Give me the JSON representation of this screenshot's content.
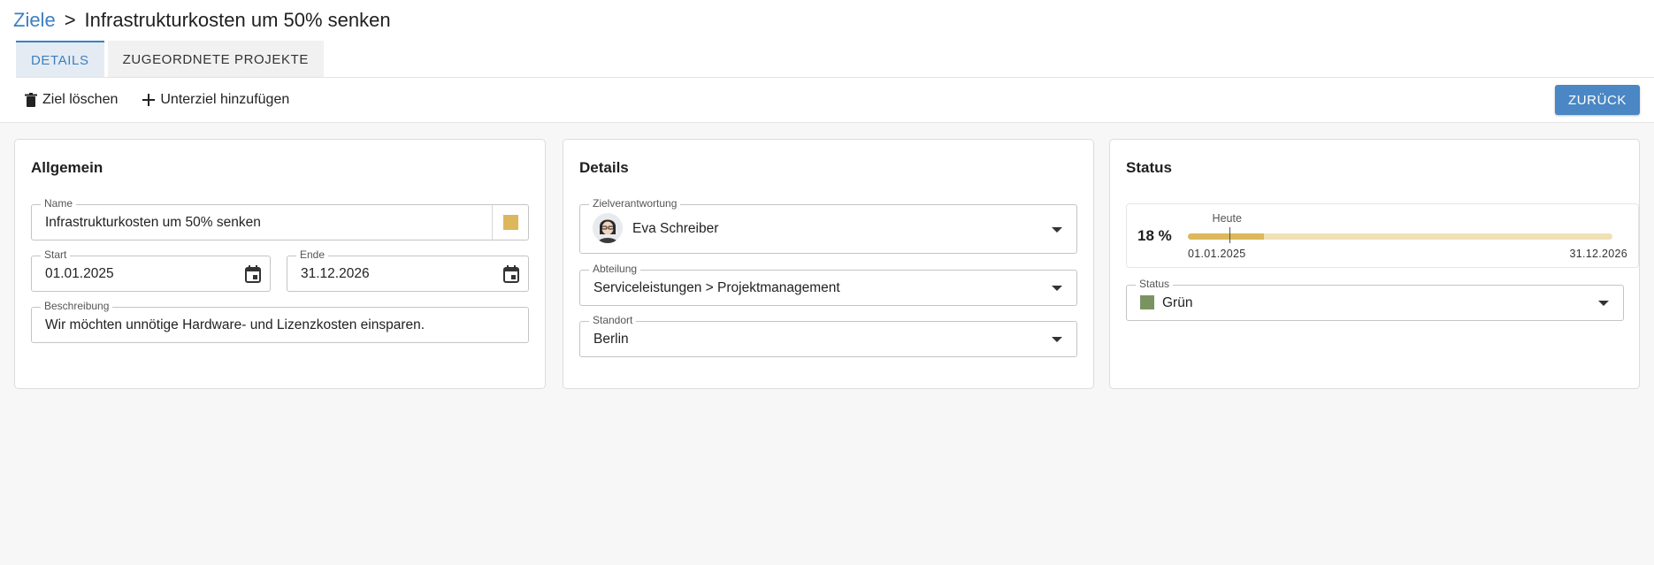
{
  "breadcrumb": {
    "parent": "Ziele",
    "separator": ">",
    "current": "Infrastrukturkosten um 50% senken"
  },
  "tabs": [
    {
      "label": "DETAILS",
      "active": true
    },
    {
      "label": "ZUGEORDNETE PROJEKTE",
      "active": false
    }
  ],
  "toolbar": {
    "delete_label": "Ziel löschen",
    "add_sub_label": "Unterziel hinzufügen",
    "back_label": "ZURÜCK"
  },
  "general": {
    "title": "Allgemein",
    "name_label": "Name",
    "name_value": "Infrastrukturkosten um 50% senken",
    "color": "#dcb75c",
    "start_label": "Start",
    "start_value": "01.01.2025",
    "end_label": "Ende",
    "end_value": "31.12.2026",
    "description_label": "Beschreibung",
    "description_value": "Wir möchten unnötige Hardware- und Lizenzkosten einsparen."
  },
  "details": {
    "title": "Details",
    "owner_label": "Zielverantwortung",
    "owner_value": "Eva Schreiber",
    "department_label": "Abteilung",
    "department_value": "Serviceleistungen > Projektmanagement",
    "location_label": "Standort",
    "location_value": "Berlin"
  },
  "status": {
    "title": "Status",
    "progress_text": "18 %",
    "progress_fraction": 0.18,
    "today_label": "Heute",
    "today_fraction": 0.097,
    "range_start": "01.01.2025",
    "range_end": "31.12.2026",
    "status_label": "Status",
    "status_value": "Grün",
    "status_color": "#7a9461",
    "accent_color": "#4a87c4"
  }
}
